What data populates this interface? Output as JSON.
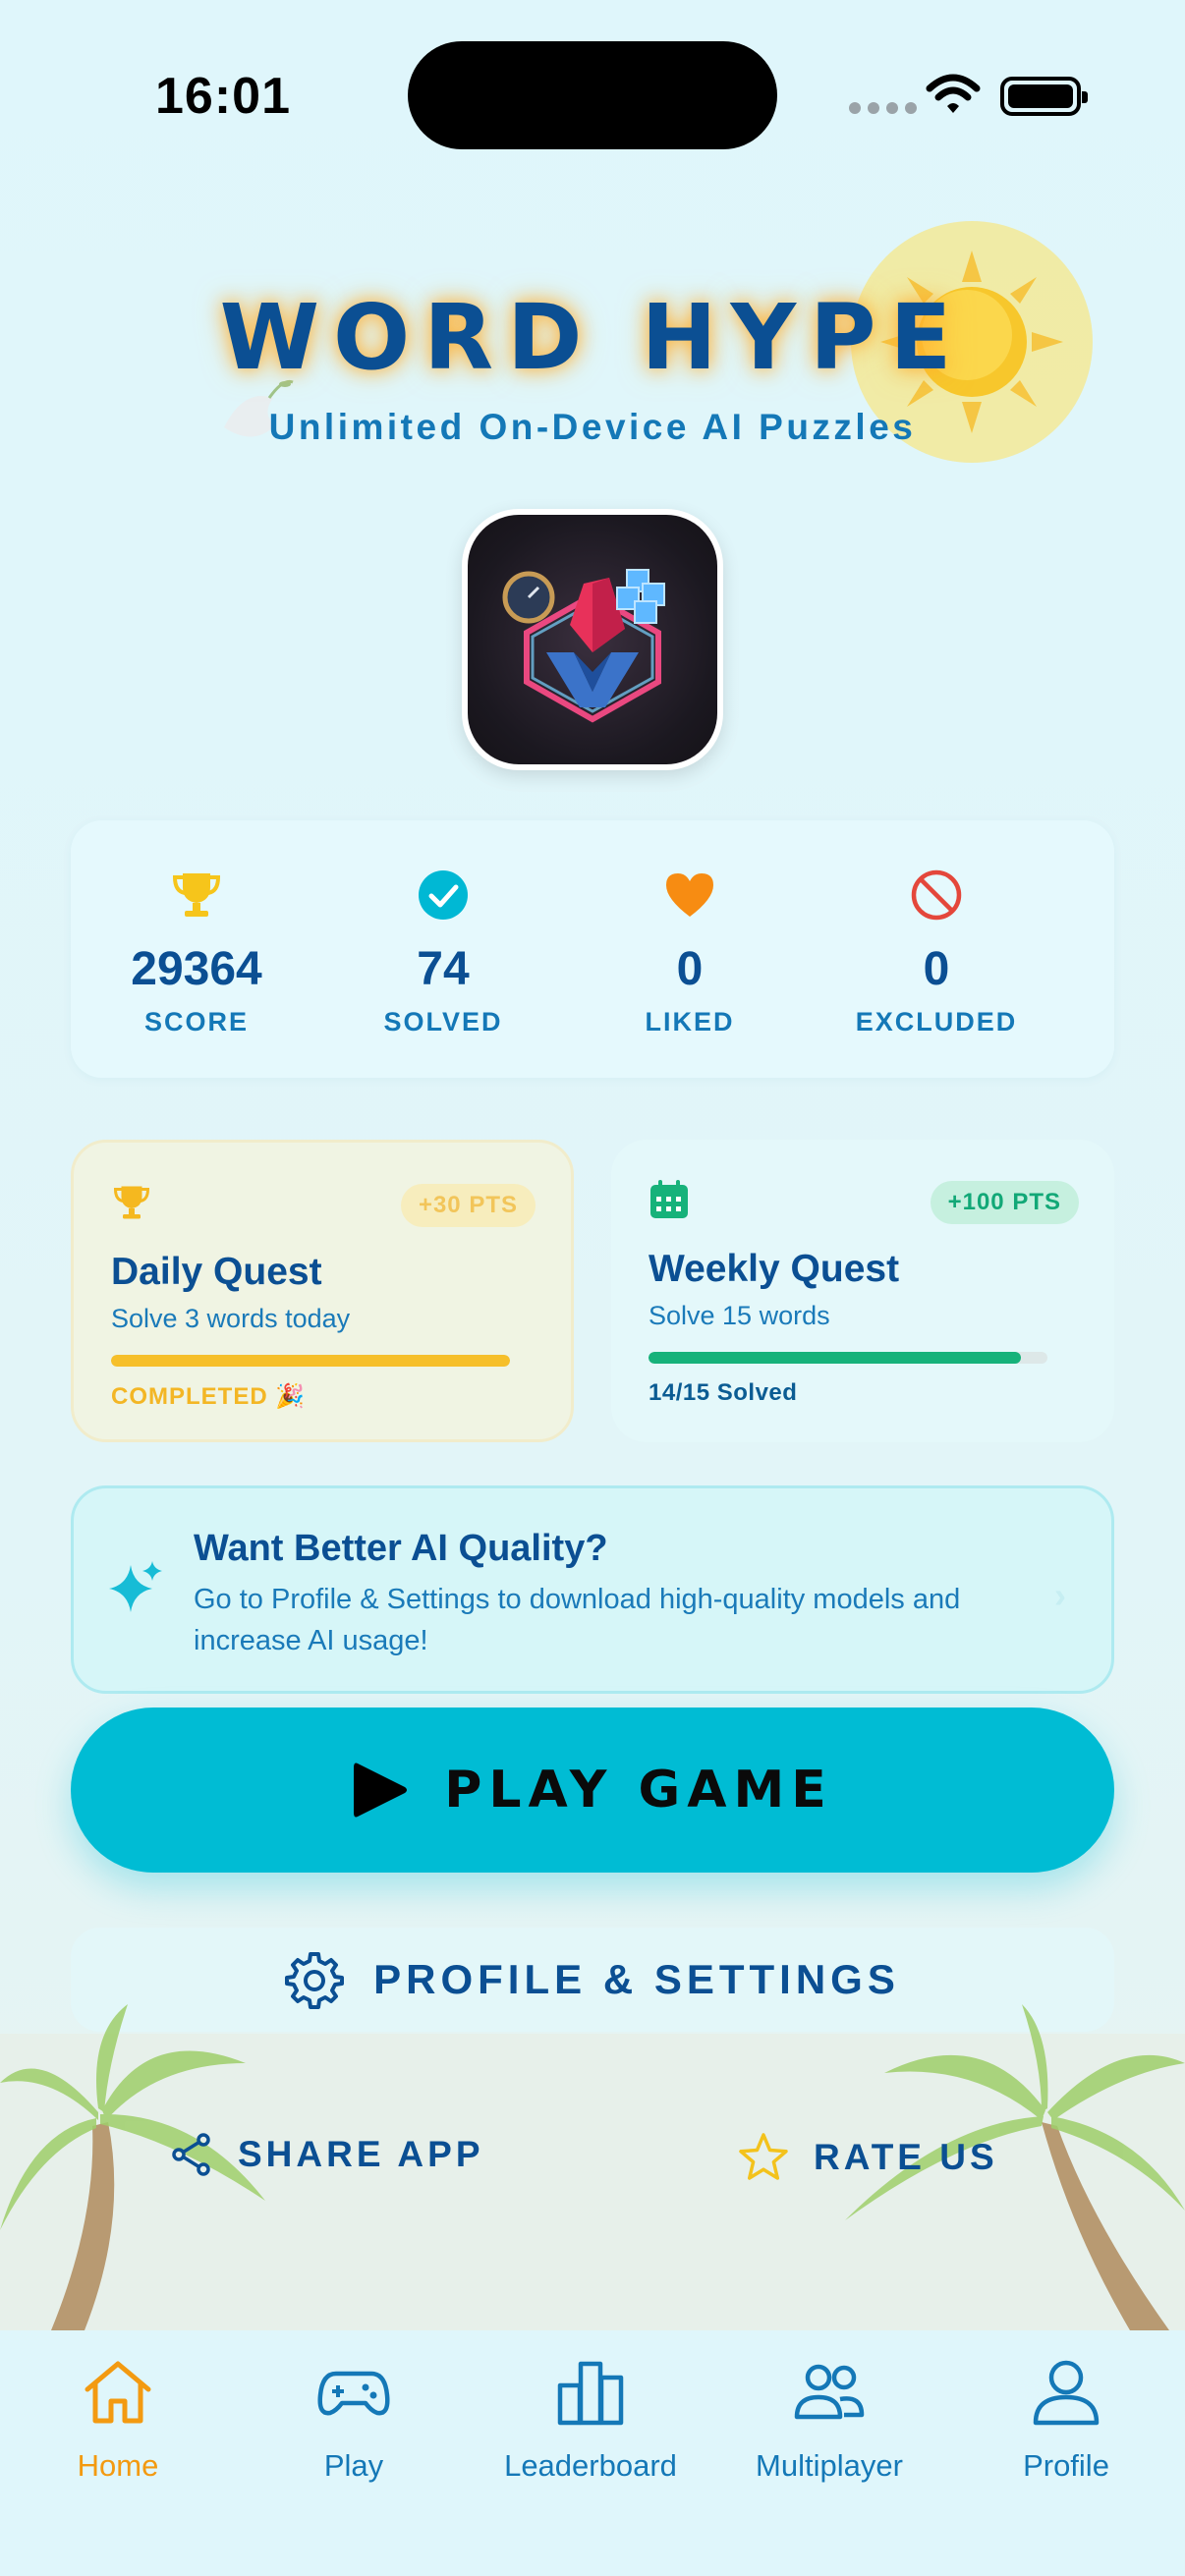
{
  "status_bar": {
    "time": "16:01"
  },
  "header": {
    "title": "WORD HYPE",
    "subtitle": "Unlimited On-Device AI Puzzles"
  },
  "stats": [
    {
      "icon": "trophy-icon",
      "value": "29364",
      "label": "SCORE"
    },
    {
      "icon": "check-circle-icon",
      "value": "74",
      "label": "SOLVED"
    },
    {
      "icon": "heart-icon",
      "value": "0",
      "label": "LIKED"
    },
    {
      "icon": "block-icon",
      "value": "0",
      "label": "EXCLUDED"
    }
  ],
  "quests": {
    "daily": {
      "title": "Daily Quest",
      "subtitle": "Solve 3 words today",
      "badge": "+30 PTS",
      "status": "COMPLETED 🎉",
      "progress": 1.0
    },
    "weekly": {
      "title": "Weekly Quest",
      "subtitle": "Solve 15 words",
      "badge": "+100 PTS",
      "status": "14/15 Solved",
      "progress": 0.9333
    }
  },
  "ai_banner": {
    "title": "Want Better AI Quality?",
    "description": "Go to Profile & Settings to download high-quality models and increase AI usage!"
  },
  "buttons": {
    "play": "PLAY GAME",
    "settings": "PROFILE & SETTINGS",
    "share": "SHARE APP",
    "rate": "RATE US"
  },
  "tabs": [
    {
      "label": "Home",
      "icon": "home-icon",
      "active": true
    },
    {
      "label": "Play",
      "icon": "gamepad-icon",
      "active": false
    },
    {
      "label": "Leaderboard",
      "icon": "bar-chart-icon",
      "active": false
    },
    {
      "label": "Multiplayer",
      "icon": "users-icon",
      "active": false
    },
    {
      "label": "Profile",
      "icon": "person-icon",
      "active": false
    }
  ],
  "colors": {
    "primary": "#0b4f93",
    "accent": "#00bcd4",
    "active_tab": "#f39a11",
    "gold": "#f6bf2a",
    "green": "#16b27a"
  }
}
